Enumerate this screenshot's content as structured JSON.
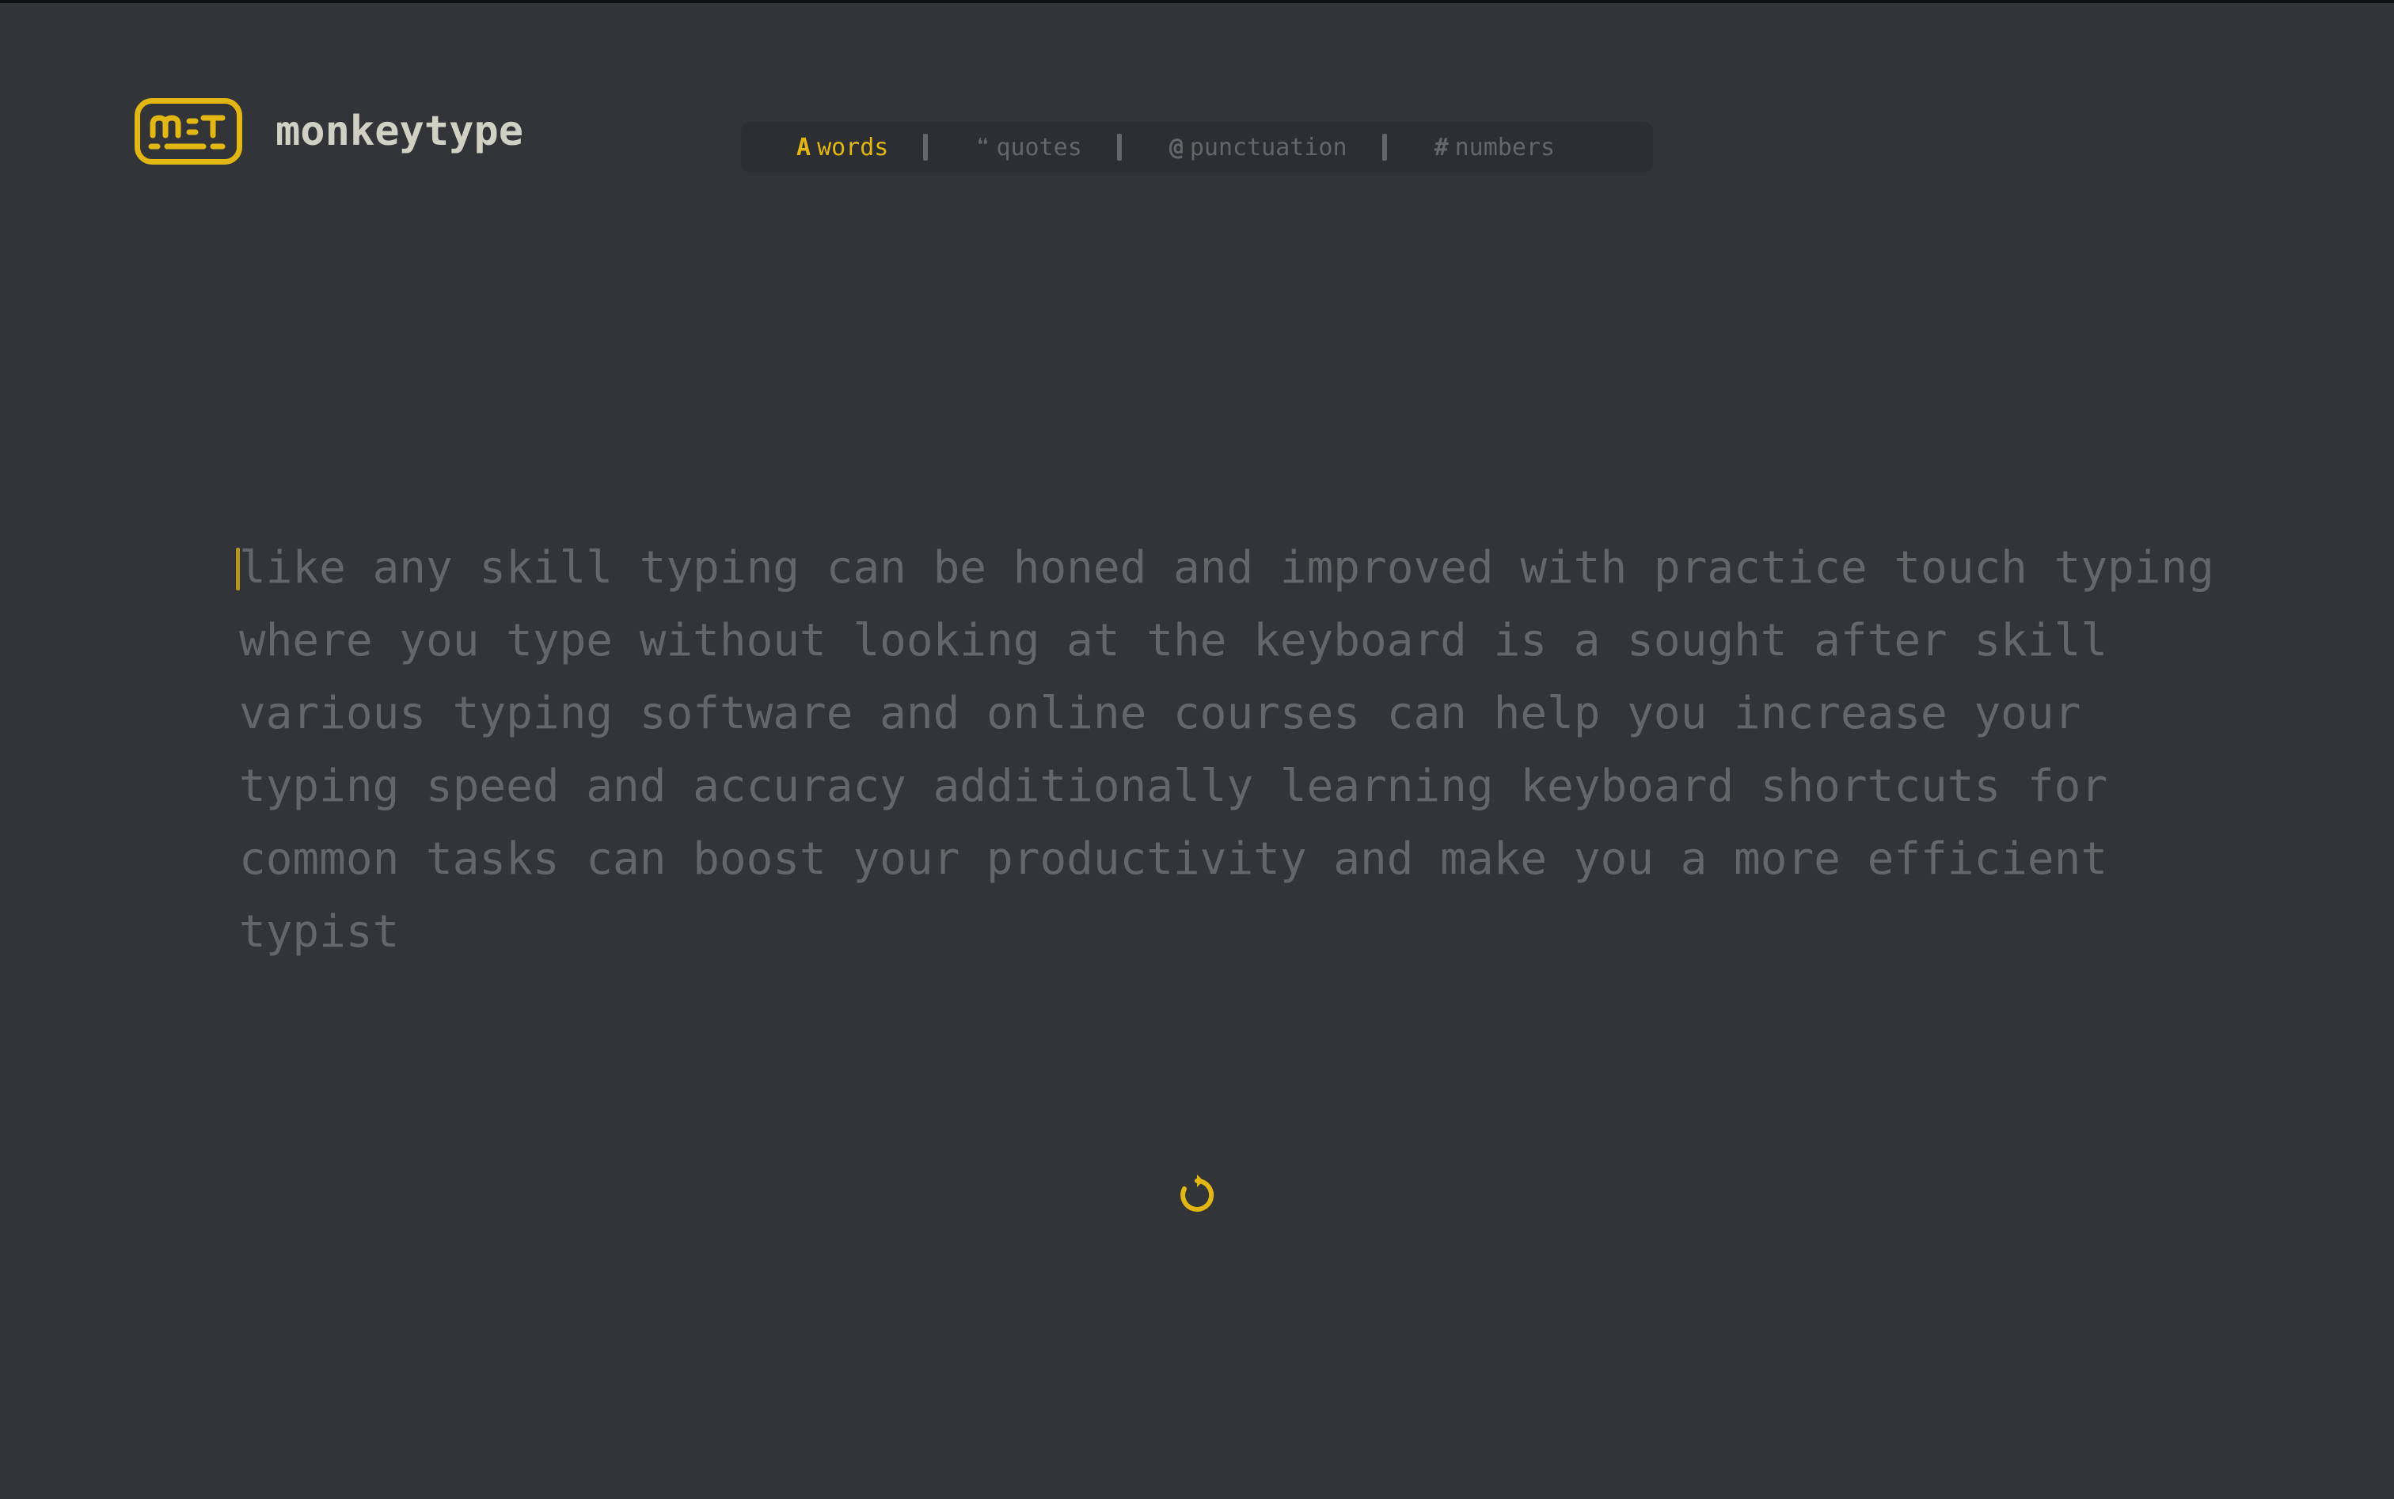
{
  "header": {
    "brand": "monkeytype",
    "logo_icon": "monkeytype-keyboard-logo-icon"
  },
  "modes": [
    {
      "glyph": "A",
      "label": "words",
      "active": true,
      "icon": "letter-a-icon"
    },
    {
      "glyph": "❝",
      "label": "quotes",
      "active": false,
      "icon": "quote-icon"
    },
    {
      "glyph": "@",
      "label": "punctuation",
      "active": false,
      "icon": "at-sign-icon"
    },
    {
      "glyph": "#",
      "label": "numbers",
      "active": false,
      "icon": "hash-icon"
    }
  ],
  "test": {
    "lines": [
      "like any skill typing can be honed and improved with practice touch typing",
      "where you type without looking at the keyboard is a sought after skill",
      "various typing software and online courses can help you increase your",
      "typing speed and accuracy additionally learning keyboard shortcuts for",
      "common tasks can boost your productivity and make you a more efficient",
      "typist"
    ]
  },
  "restart": {
    "icon": "restart-icon",
    "glyph": "↻"
  },
  "colors": {
    "background": "#323437",
    "accent": "#e2b714",
    "text": "#d1d0c5",
    "subtext": "#646669",
    "bar": "#2c2e31"
  }
}
